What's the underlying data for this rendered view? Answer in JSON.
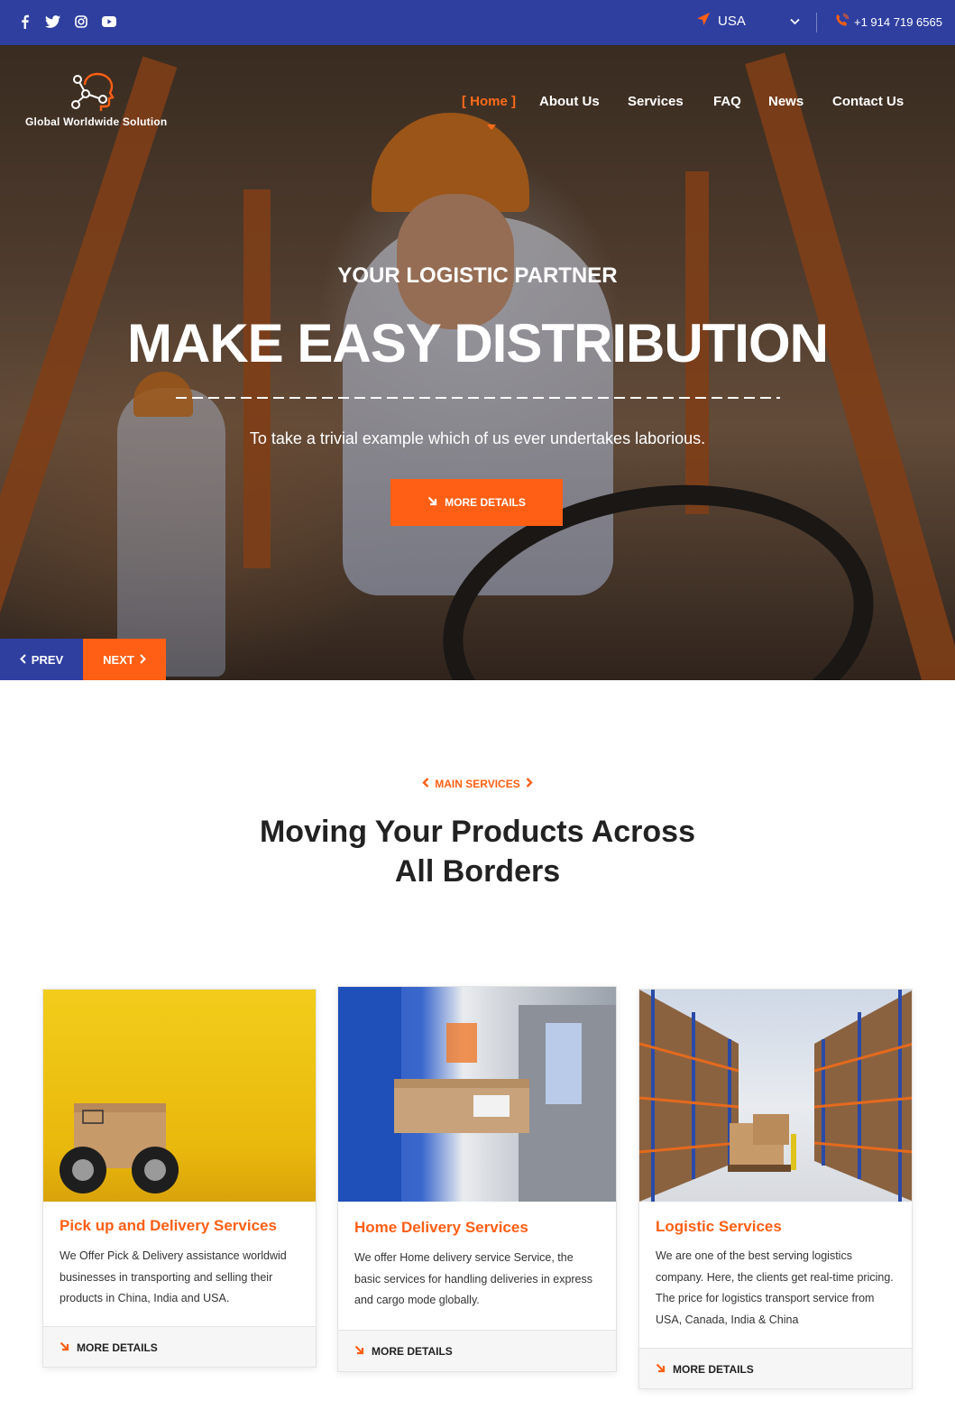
{
  "topbar": {
    "social": [
      {
        "name": "facebook-icon"
      },
      {
        "name": "twitter-icon"
      },
      {
        "name": "instagram-icon"
      },
      {
        "name": "youtube-icon"
      }
    ],
    "country": "USA",
    "phone": "+1 914 719 6565"
  },
  "brand": {
    "name": "Global Worldwide Solution",
    "accent": "#ff5f14",
    "primary": "#2f3fa0"
  },
  "nav": {
    "items": [
      {
        "label": "[ Home ]",
        "active": true
      },
      {
        "label": "About Us"
      },
      {
        "label": "Services"
      },
      {
        "label": "FAQ"
      },
      {
        "label": "News"
      },
      {
        "label": "Contact Us"
      }
    ]
  },
  "hero": {
    "kicker": "YOUR LOGISTIC PARTNER",
    "title": "MAKE EASY DISTRIBUTION",
    "subtitle": "To take a trivial example which of us ever undertakes laborious.",
    "button": "MORE DETAILS",
    "prev": "PREV",
    "next": "NEXT"
  },
  "services": {
    "kicker": "MAIN SERVICES",
    "title_line1": "Moving Your Products Across",
    "title_line2": "All Borders",
    "cards": [
      {
        "title": "Pick up and Delivery Services",
        "text": "We Offer Pick & Delivery assistance worldwid businesses in transporting and selling their products in China, India and USA.",
        "button": "MORE DETAILS"
      },
      {
        "title": "Home Delivery Services",
        "text": "We offer Home delivery service Service, the basic services for handling deliveries in express and cargo mode globally.",
        "button": "MORE DETAILS"
      },
      {
        "title": "Logistic Services",
        "text": "We are one of the best serving logistics company. Here, the clients get real-time pricing. The price for logistics transport service from USA, Canada, India & China",
        "button": "MORE DETAILS"
      }
    ]
  }
}
